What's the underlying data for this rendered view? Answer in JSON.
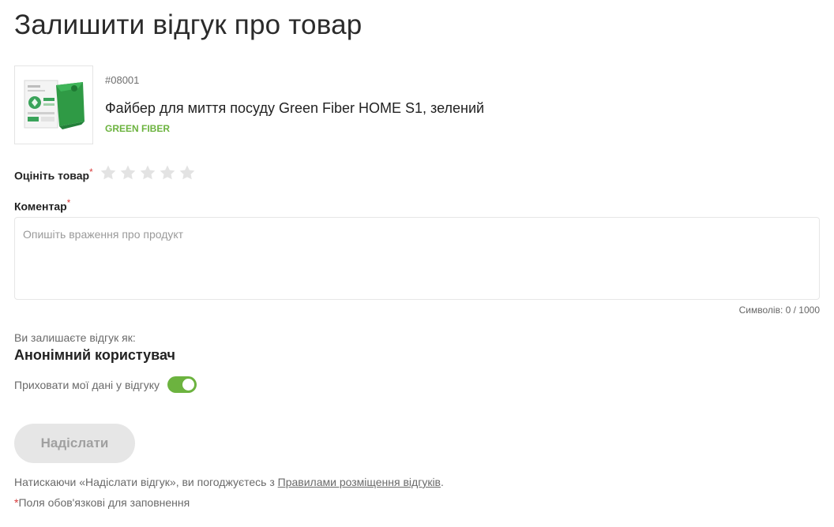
{
  "page": {
    "title": "Залишити відгук про товар"
  },
  "product": {
    "sku": "#08001",
    "name": "Файбер для миття посуду Green Fiber HOME S1, зелений",
    "brand": "GREEN FIBER",
    "image_icon": "product-package-image"
  },
  "rating": {
    "label": "Оцініть товар",
    "required_mark": "*",
    "max_stars": 5,
    "value": 0,
    "star_color_empty": "#e3e3e3"
  },
  "comment": {
    "label": "Коментар",
    "required_mark": "*",
    "placeholder": "Опишіть враження про продукт",
    "value": "",
    "counter": "Символів: 0 / 1000"
  },
  "reviewer": {
    "caption": "Ви залишаєте відгук як:",
    "name": "Анонімний користувач"
  },
  "hide_data": {
    "label": "Приховати мої дані у відгуку",
    "enabled": true,
    "accent_color": "#6cb33f"
  },
  "submit": {
    "label": "Надіслати",
    "disabled": true
  },
  "agreement": {
    "prefix": "Натискаючи «Надіслати відгук», ви погоджуєтесь з ",
    "link_text": "Правилами розміщення відгуків",
    "suffix": "."
  },
  "footer_note": {
    "mark": "*",
    "text": "Поля обов'язкові для заповнення"
  }
}
